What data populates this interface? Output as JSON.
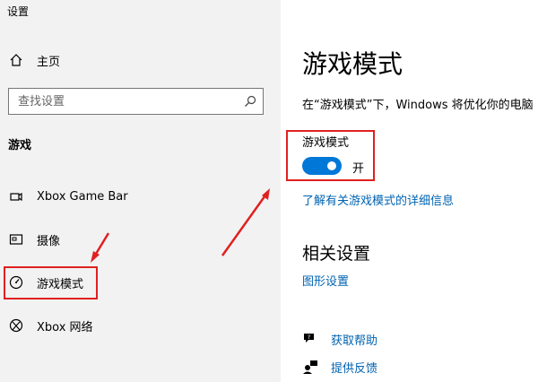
{
  "window": {
    "title": "设置"
  },
  "sidebar": {
    "home_label": "主页",
    "search_placeholder": "查找设置",
    "section_title": "游戏",
    "items": [
      {
        "label": "Xbox Game Bar",
        "icon": "xbox-game-bar-icon"
      },
      {
        "label": "摄像",
        "icon": "capture-icon"
      },
      {
        "label": "游戏模式",
        "icon": "game-mode-icon",
        "selected": true
      },
      {
        "label": "Xbox 网络",
        "icon": "xbox-icon"
      }
    ]
  },
  "main": {
    "title": "游戏模式",
    "description": "在“游戏模式”下，Windows 将优化你的电脑",
    "toggle": {
      "label": "游戏模式",
      "state_text": "开",
      "on": true
    },
    "learn_more": "了解有关游戏模式的详细信息",
    "related": {
      "title": "相关设置",
      "graphics_link": "图形设置"
    },
    "help": {
      "get_help": "获取帮助",
      "feedback": "提供反馈"
    }
  },
  "colors": {
    "accent": "#0078d7",
    "link": "#0063b1",
    "annotation": "#e02020",
    "sidebar_bg": "#f2f2f2"
  }
}
